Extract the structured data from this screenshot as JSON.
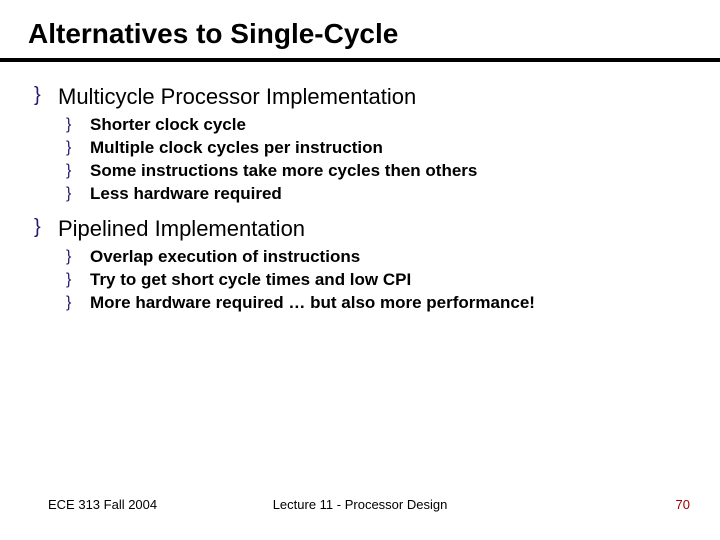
{
  "title": "Alternatives to Single-Cycle",
  "sections": [
    {
      "heading": "Multicycle Processor Implementation",
      "items": [
        "Shorter clock cycle",
        "Multiple clock cycles per instruction",
        "Some instructions take more cycles then others",
        "Less hardware required"
      ]
    },
    {
      "heading": "Pipelined Implementation",
      "items": [
        "Overlap execution of instructions",
        "Try to get short cycle times and low CPI",
        "More hardware required … but also more performance!"
      ]
    }
  ],
  "footer": {
    "left": "ECE 313 Fall 2004",
    "center": "Lecture 11 - Processor Design",
    "page": "70"
  }
}
